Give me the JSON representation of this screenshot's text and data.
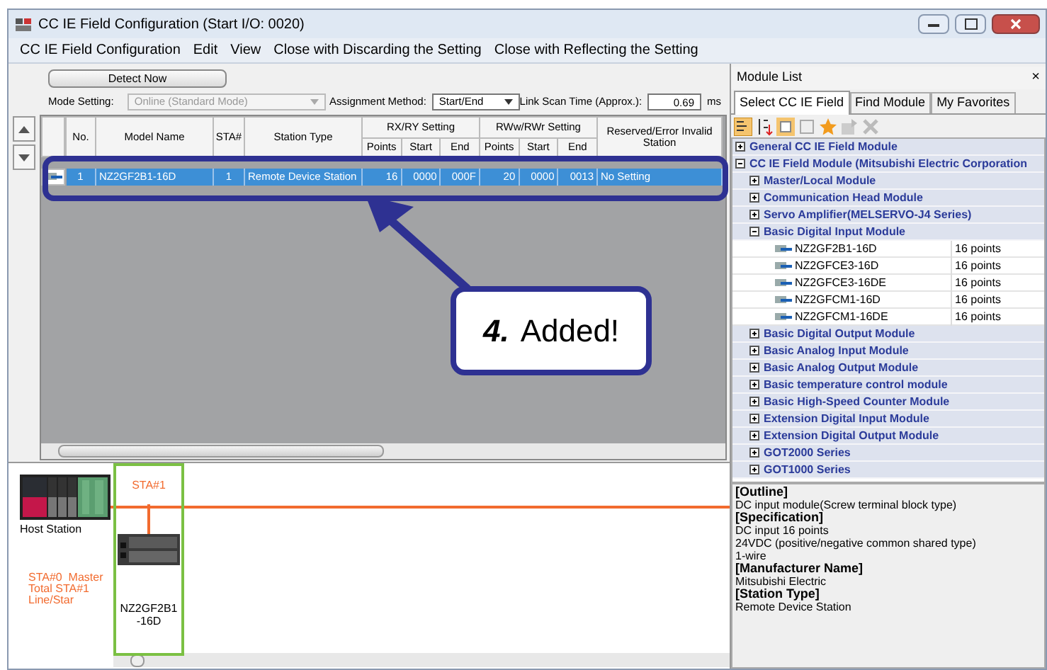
{
  "window": {
    "title": "CC IE Field Configuration (Start I/O: 0020)"
  },
  "menu": [
    {
      "label": "CC IE Field Configuration"
    },
    {
      "label": "Edit"
    },
    {
      "label": "View"
    },
    {
      "label": "Close with Discarding the Setting"
    },
    {
      "label": "Close with Reflecting the Setting"
    }
  ],
  "toolbar": {
    "detect_button": "Detect Now",
    "mode_label": "Mode Setting:",
    "mode_value": "Online (Standard Mode)",
    "mode_disabled": true,
    "assignment_label": "Assignment Method:",
    "assignment_value": "Start/End",
    "scan_label": "Link Scan Time (Approx.):",
    "scan_value": "0.69",
    "scan_unit": "ms"
  },
  "table": {
    "columns": [
      {
        "label": "No."
      },
      {
        "label": "Model Name"
      },
      {
        "label": "STA#"
      },
      {
        "label": "Station Type"
      },
      {
        "label": "RX/RY Setting",
        "colspan": 3,
        "children": [
          "Points",
          "Start",
          "End"
        ]
      },
      {
        "label": "RWw/RWr Setting",
        "colspan": 3,
        "children": [
          "Points",
          "Start",
          "End"
        ]
      },
      {
        "label": "Reserved/Error Invalid Station"
      }
    ],
    "rows": [
      {
        "selected": true,
        "cells": [
          "1",
          "NZ2GF2B1-16D",
          "1",
          "Remote Device Station",
          "16",
          "0000",
          "000F",
          "20",
          "0000",
          "0013",
          "No Setting"
        ]
      }
    ]
  },
  "diagram": {
    "host_label": "Host Station",
    "master_info": [
      "STA#0  Master",
      "Total STA#1",
      "Line/Star"
    ],
    "stations": [
      {
        "header": "STA#1",
        "model_lines": [
          "NZ2GF2B1",
          "-16D"
        ],
        "selected": true
      }
    ]
  },
  "annotation": {
    "number": "4.",
    "text": "Added!"
  },
  "module_list": {
    "title": "Module List",
    "close": "×",
    "tabs": [
      {
        "label": "Select CC IE Field",
        "selected": true
      },
      {
        "label": "Find Module",
        "selected": false
      },
      {
        "label": "My Favorites",
        "selected": false
      }
    ],
    "tree": [
      {
        "label": "General CC IE Field Module",
        "expanded": false
      },
      {
        "label": "CC IE Field Module (Mitsubishi Electric Corporation",
        "expanded": true,
        "children": [
          {
            "label": "Master/Local Module",
            "expanded": false
          },
          {
            "label": "Communication Head Module",
            "expanded": false
          },
          {
            "label": "Servo Amplifier(MELSERVO-J4 Series)",
            "expanded": false
          },
          {
            "label": "Basic Digital Input Module",
            "expanded": true,
            "children": [
              {
                "kind": "module",
                "label": "NZ2GF2B1-16D",
                "points": "16 points"
              },
              {
                "kind": "module",
                "label": "NZ2GFCE3-16D",
                "points": "16 points"
              },
              {
                "kind": "module",
                "label": "NZ2GFCE3-16DE",
                "points": "16 points"
              },
              {
                "kind": "module",
                "label": "NZ2GFCM1-16D",
                "points": "16 points"
              },
              {
                "kind": "module",
                "label": "NZ2GFCM1-16DE",
                "points": "16 points"
              }
            ]
          },
          {
            "label": "Basic Digital Output Module",
            "expanded": false
          },
          {
            "label": "Basic Analog Input Module",
            "expanded": false
          },
          {
            "label": "Basic Analog Output Module",
            "expanded": false
          },
          {
            "label": "Basic temperature control module",
            "expanded": false
          },
          {
            "label": "Basic High-Speed Counter Module",
            "expanded": false
          },
          {
            "label": "Extension Digital Input Module",
            "expanded": false
          },
          {
            "label": "Extension Digital Output Module",
            "expanded": false
          },
          {
            "label": "GOT2000 Series",
            "expanded": false
          },
          {
            "label": "GOT1000 Series",
            "expanded": false
          }
        ]
      }
    ],
    "description": [
      {
        "kind": "heading",
        "text": "[Outline]"
      },
      {
        "kind": "text",
        "text": "DC input module(Screw terminal block type)"
      },
      {
        "kind": "heading",
        "text": "[Specification]"
      },
      {
        "kind": "text",
        "text": "DC input 16 points"
      },
      {
        "kind": "text",
        "text": "24VDC (positive/negative common shared type)"
      },
      {
        "kind": "text",
        "text": "1-wire"
      },
      {
        "kind": "heading",
        "text": "[Manufacturer Name]"
      },
      {
        "kind": "text",
        "text": "Mitsubishi Electric"
      },
      {
        "kind": "heading",
        "text": "[Station Type]"
      },
      {
        "kind": "text",
        "text": "Remote Device Station"
      }
    ]
  }
}
